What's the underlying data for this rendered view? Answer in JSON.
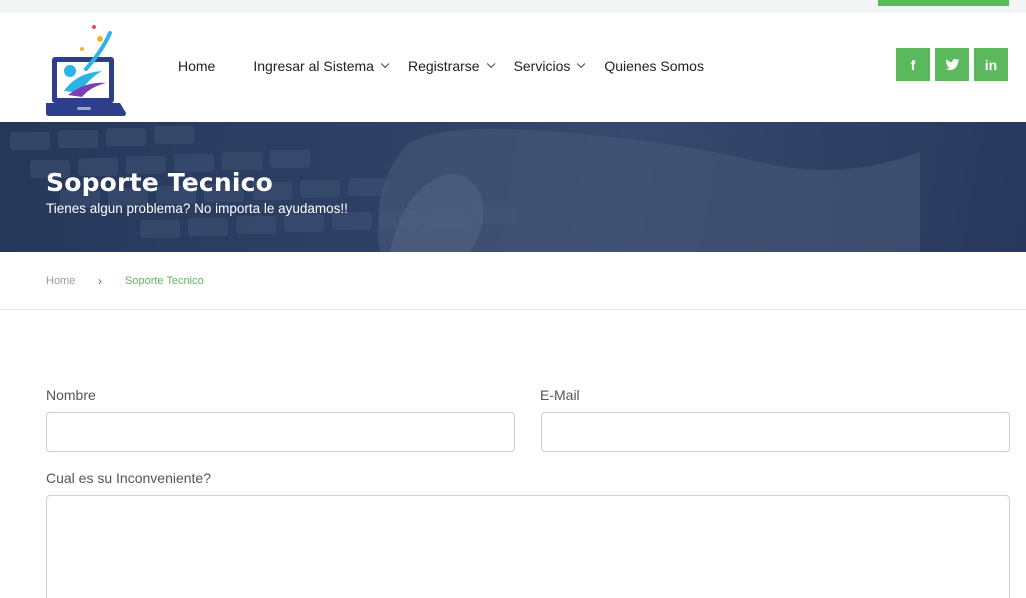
{
  "nav": {
    "items": [
      {
        "label": "Home",
        "has_dropdown": false
      },
      {
        "label": "Ingresar al Sistema",
        "has_dropdown": true
      },
      {
        "label": "Registrarse",
        "has_dropdown": true
      },
      {
        "label": "Servicios",
        "has_dropdown": true
      },
      {
        "label": "Quienes Somos",
        "has_dropdown": false
      }
    ]
  },
  "social": {
    "facebook": "f",
    "twitter_icon": "twitter-icon",
    "linkedin": "in"
  },
  "hero": {
    "title": "Soporte Tecnico",
    "subtitle": "Tienes algun problema? No importa le ayudamos!!"
  },
  "breadcrumb": {
    "home": "Home",
    "separator": "›",
    "current": "Soporte Tecnico"
  },
  "form": {
    "nombre_label": "Nombre",
    "nombre_value": "",
    "email_label": "E-Mail",
    "email_value": "",
    "problema_label": "Cual es su Inconveniente?",
    "problema_value": ""
  },
  "colors": {
    "accent": "#5cb85c",
    "hero": "#2c3e5e"
  }
}
